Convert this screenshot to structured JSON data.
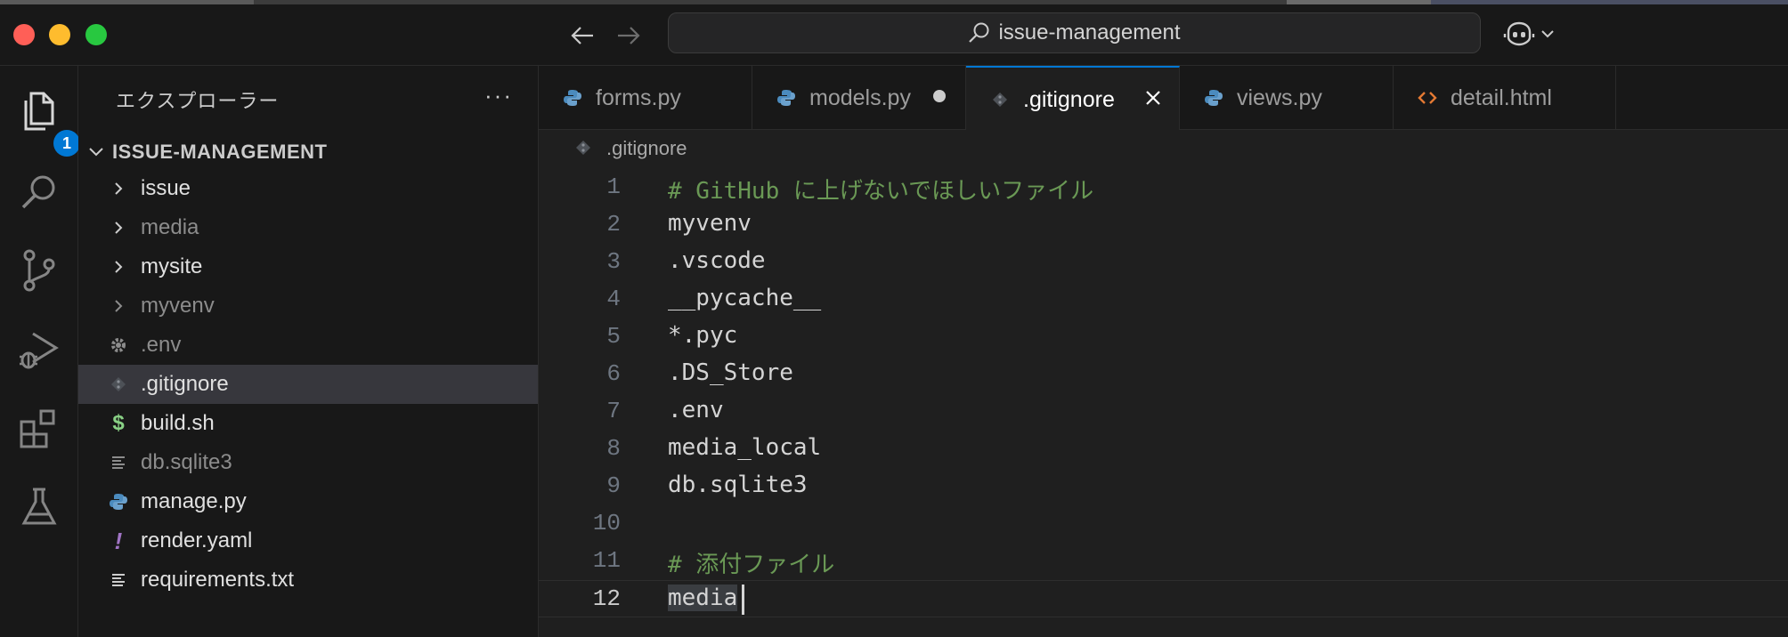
{
  "window": {
    "search_text": "issue-management"
  },
  "activity_bar": {
    "explorer_badge": "1",
    "items": [
      "explorer-icon",
      "search-icon",
      "source-control-icon",
      "run-debug-icon",
      "extensions-icon",
      "testing-icon"
    ]
  },
  "sidebar": {
    "title": "エクスプローラー",
    "more": "···",
    "root_label": "ISSUE-MANAGEMENT",
    "items": [
      {
        "label": "issue",
        "kind": "folder"
      },
      {
        "label": "media",
        "kind": "folder"
      },
      {
        "label": "mysite",
        "kind": "folder"
      },
      {
        "label": "myvenv",
        "kind": "folder"
      },
      {
        "label": ".env",
        "kind": "gear"
      },
      {
        "label": ".gitignore",
        "kind": "git"
      },
      {
        "label": "build.sh",
        "kind": "shell"
      },
      {
        "label": "db.sqlite3",
        "kind": "lines"
      },
      {
        "label": "manage.py",
        "kind": "python"
      },
      {
        "label": "render.yaml",
        "kind": "yaml"
      },
      {
        "label": "requirements.txt",
        "kind": "lines"
      }
    ]
  },
  "tabs": [
    {
      "label": "forms.py"
    },
    {
      "label": "models.py"
    },
    {
      "label": ".gitignore"
    },
    {
      "label": "views.py"
    },
    {
      "label": "detail.html"
    }
  ],
  "breadcrumb": {
    "file": ".gitignore"
  },
  "editor": {
    "lines": [
      {
        "num": "1",
        "text": "# GitHub に上げないでほしいファイル"
      },
      {
        "num": "2",
        "text": "myvenv"
      },
      {
        "num": "3",
        "text": ".vscode"
      },
      {
        "num": "4",
        "text": "__pycache__"
      },
      {
        "num": "5",
        "text": "*.pyc"
      },
      {
        "num": "6",
        "text": ".DS_Store"
      },
      {
        "num": "7",
        "text": ".env"
      },
      {
        "num": "8",
        "text": "media_local"
      },
      {
        "num": "9",
        "text": "db.sqlite3"
      },
      {
        "num": "10",
        "text": ""
      },
      {
        "num": "11",
        "text": "# 添付ファイル"
      },
      {
        "num": "12",
        "text": "media"
      }
    ]
  },
  "colors": {
    "accent": "#0078d4",
    "comment": "#6a9955",
    "python_icon": "#4b8bbe",
    "html_icon": "#e37933",
    "shell_icon": "#89d185",
    "yaml_icon": "#a074c4"
  }
}
